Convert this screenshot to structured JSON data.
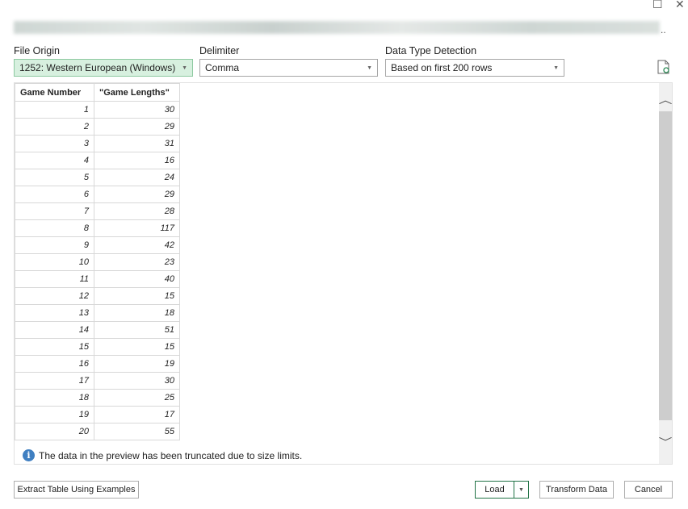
{
  "window": {
    "maximize_icon": "maximize-icon",
    "close_icon": "close-icon",
    "source_ellipsis": ".."
  },
  "file_origin": {
    "label": "File Origin",
    "value": "1252: Western European (Windows)"
  },
  "delimiter": {
    "label": "Delimiter",
    "value": "Comma"
  },
  "data_type_detection": {
    "label": "Data Type Detection",
    "value": "Based on first 200 rows"
  },
  "preview": {
    "columns": [
      "Game Number",
      "\"Game Lengths\""
    ],
    "rows": [
      [
        1,
        30
      ],
      [
        2,
        29
      ],
      [
        3,
        31
      ],
      [
        4,
        16
      ],
      [
        5,
        24
      ],
      [
        6,
        29
      ],
      [
        7,
        28
      ],
      [
        8,
        117
      ],
      [
        9,
        42
      ],
      [
        10,
        23
      ],
      [
        11,
        40
      ],
      [
        12,
        15
      ],
      [
        13,
        18
      ],
      [
        14,
        51
      ],
      [
        15,
        15
      ],
      [
        16,
        19
      ],
      [
        17,
        30
      ],
      [
        18,
        25
      ],
      [
        19,
        17
      ],
      [
        20,
        55
      ]
    ],
    "info": "The data in the preview has been truncated due to size limits."
  },
  "buttons": {
    "extract": "Extract Table Using Examples",
    "load": "Load",
    "transform": "Transform Data",
    "cancel": "Cancel"
  },
  "colors": {
    "accent": "#217346",
    "selected_field": "#d7f0df",
    "info": "#3f7fc1"
  }
}
